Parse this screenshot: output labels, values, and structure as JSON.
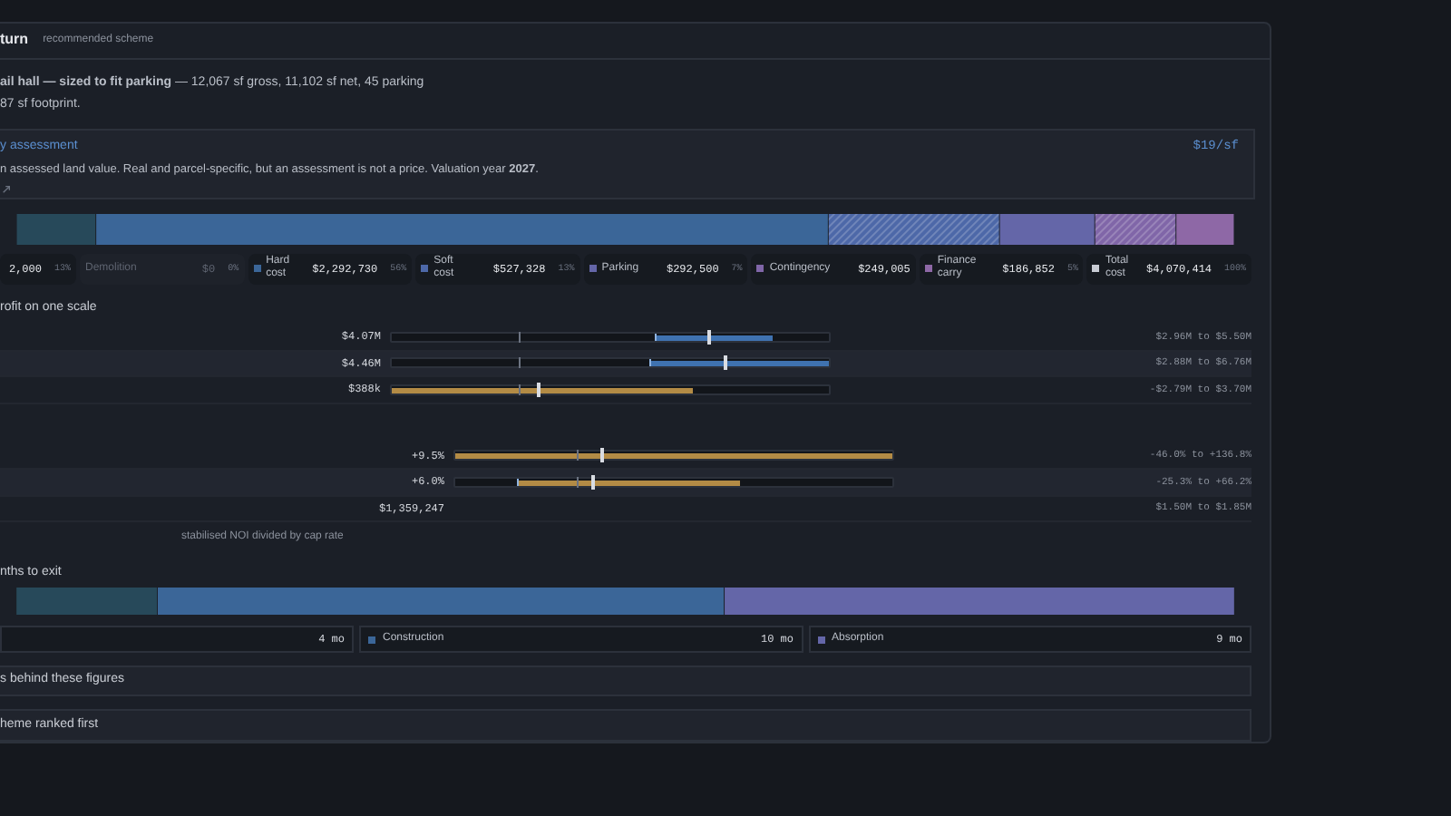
{
  "header": {
    "title": "turn",
    "subtitle": "recommended scheme"
  },
  "description": {
    "lines": [
      "**ail hall — sized to fit parking** — 12,067 sf gross, 11,102 sf net, 45 parking",
      "87 sf footprint."
    ]
  },
  "assessment": {
    "link": "y assessment",
    "rate": "$19/sf",
    "text": "n assessed land value. Real and parcel-specific, but an assessment is not a price. Valuation year **2027**."
  },
  "cost_legend": [
    {
      "value": "2,000",
      "share": "13%",
      "dim": false
    },
    {
      "label": "Demolition",
      "value": "$0",
      "share": "0%",
      "dim": true
    },
    {
      "label": "Hard cost",
      "value": "$2,292,730",
      "share": "56%",
      "dim": false,
      "color": "#3b6698"
    },
    {
      "label": "Soft cost",
      "value": "$527,328",
      "share": "13%",
      "dim": false,
      "color": "#4d68a8"
    },
    {
      "label": "Parking",
      "value": "$292,500",
      "share": "7%",
      "dim": false,
      "color": "#6466a8"
    },
    {
      "label": "Contingency",
      "value": "$249,005",
      "dim": false,
      "color": "#8066a8"
    },
    {
      "label": "Finance carry",
      "value": "$186,852",
      "share": "5%",
      "dim": false,
      "color": "#8e68a6"
    },
    {
      "label": "Total cost",
      "value": "$4,070,414",
      "share": "100%",
      "dim": false,
      "color": "#c8ccd4"
    }
  ],
  "range_title": "rofit on one scale",
  "range_groups": [
    {
      "rows": [
        {
          "kind": "band",
          "value": "$4.07M",
          "range": "$2.96M to $5.50M",
          "low": {
            "level": 0.6
          },
          "high": {
            "level": 0.87
          },
          "marker": {
            "level": 0.72
          },
          "baseline": {
            "level": 0.29
          }
        },
        {
          "kind": "band",
          "value": "$4.46M",
          "range": "$2.88M to $6.76M",
          "low": {
            "level": 0.59
          },
          "high": {
            "level": 1
          },
          "marker": {
            "level": 0.76
          },
          "baseline": {
            "level": 0.29
          }
        },
        {
          "kind": "fill",
          "value": "$388k",
          "range": "-$2.79M to $3.70M",
          "high": {
            "level": 0.69
          },
          "marker": {
            "level": 0.33
          },
          "baseline": {
            "level": 0.29
          }
        }
      ]
    },
    {
      "rows": [
        {
          "kind": "fill",
          "value": "+9.5%",
          "range": "-46.0% to +136.8%",
          "high": {
            "level": 1
          },
          "marker": {
            "level": 0.33
          },
          "baseline": {
            "level": 0.28
          }
        },
        {
          "kind": "fill",
          "value": "+6.0%",
          "range": "-25.3% to +66.2%",
          "low": {
            "level": 0.14
          },
          "high": {
            "level": 0.65
          },
          "marker": {
            "level": 0.31
          },
          "baseline": {
            "level": 0.28
          }
        },
        {
          "kind": "text",
          "value": "$1,359,247",
          "range": "$1.50M to $1.85M"
        }
      ]
    }
  ],
  "range_caption": "stabilised NOI divided by cap rate",
  "timeline": {
    "title": "nths to exit",
    "legend": [
      {
        "value": "4 mo"
      },
      {
        "label": "Construction",
        "value": "10 mo",
        "color": "#3b6698"
      },
      {
        "label": "Absorption",
        "value": "9 mo",
        "color": "#6466a8"
      }
    ]
  },
  "sections": [
    {
      "label": "s behind these figures",
      "expanded": false
    },
    {
      "label": "heme ranked first",
      "expanded": false
    }
  ]
}
